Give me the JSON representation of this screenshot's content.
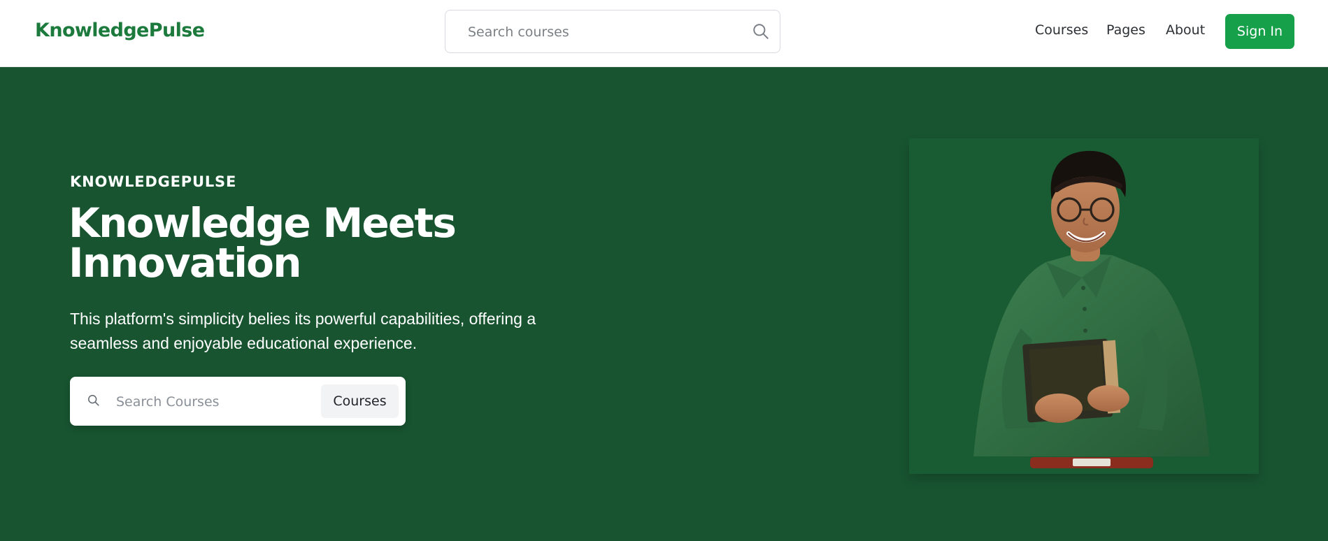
{
  "header": {
    "brand": "KnowledgePulse",
    "search_placeholder": "Search courses",
    "nav": [
      "Courses",
      "Pages",
      "About"
    ],
    "signin_label": "Sign In"
  },
  "hero": {
    "eyebrow": "KNOWLEDGEPULSE",
    "title": "Knowledge Meets Innovation",
    "description": "This platform's simplicity belies its powerful capabilities, offering a seamless and enjoyable educational experience.",
    "search_placeholder": "Search Courses",
    "courses_button": "Courses",
    "image_alt": "student holding a book"
  },
  "colors": {
    "brand_green": "#1c7a3d",
    "signin_green": "#16a04a",
    "hero_bg": "#185430"
  },
  "icons": [
    "search-icon"
  ]
}
